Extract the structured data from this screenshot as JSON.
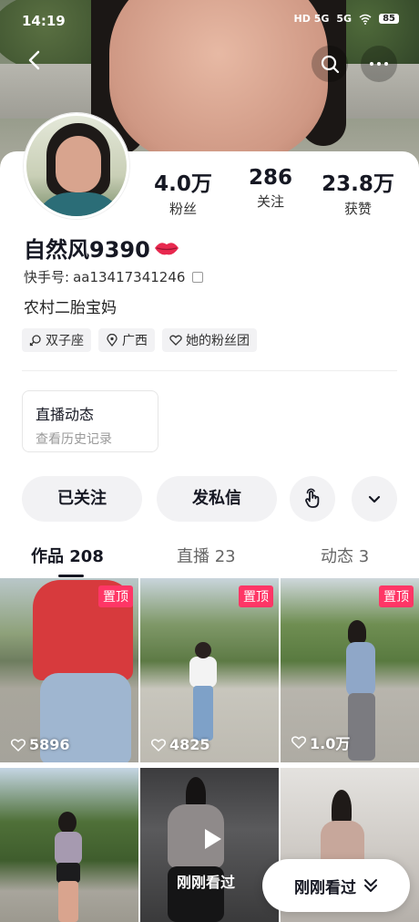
{
  "status_bar": {
    "time": "14:19",
    "signal1": "HD 5G",
    "signal2": "5G",
    "battery": "85"
  },
  "profile": {
    "username": "自然风9390",
    "kwai_id_label": "快手号:",
    "kwai_id": "aa13417341246",
    "bio": "农村二胎宝妈",
    "stats": [
      {
        "value": "4.0万",
        "label": "粉丝"
      },
      {
        "value": "286",
        "label": "关注"
      },
      {
        "value": "23.8万",
        "label": "获赞"
      }
    ],
    "tags": [
      {
        "icon": "zodiac-icon",
        "label": "双子座"
      },
      {
        "icon": "location-pin-icon",
        "label": "广西"
      },
      {
        "icon": "fan-club-icon",
        "label": "她的粉丝团"
      }
    ]
  },
  "live_card": {
    "title": "直播动态",
    "subtitle": "查看历史记录"
  },
  "actions": {
    "followed": "已关注",
    "message": "发私信"
  },
  "tabs": [
    {
      "label": "作品 208",
      "active": true
    },
    {
      "label": "直播 23",
      "active": false
    },
    {
      "label": "动态 3",
      "active": false
    }
  ],
  "videos": [
    {
      "pinned": "置顶",
      "likes": "5896"
    },
    {
      "pinned": "置顶",
      "likes": "4825"
    },
    {
      "pinned": "置顶",
      "likes": "1.0万"
    },
    {
      "pinned": "",
      "likes": ""
    },
    {
      "pinned": "",
      "likes": "",
      "overlay": "刚刚看过"
    },
    {
      "pinned": "",
      "likes": ""
    }
  ],
  "float_button": {
    "label": "刚刚看过"
  },
  "colors": {
    "accent_pin": "#fe3666",
    "text": "#161823",
    "button_bg": "#f2f2f4"
  }
}
